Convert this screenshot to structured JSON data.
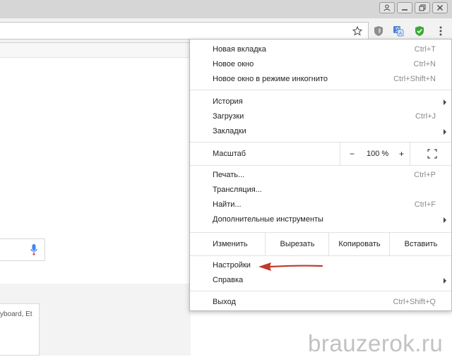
{
  "menu": {
    "items": [
      {
        "label": "Новая вкладка",
        "shortcut": "Ctrl+T"
      },
      {
        "label": "Новое окно",
        "shortcut": "Ctrl+N"
      },
      {
        "label": "Новое окно в режиме инкогнито",
        "shortcut": "Ctrl+Shift+N"
      },
      {
        "label": "История",
        "shortcut": ""
      },
      {
        "label": "Загрузки",
        "shortcut": "Ctrl+J"
      },
      {
        "label": "Закладки",
        "shortcut": ""
      },
      {
        "label": "Печать...",
        "shortcut": "Ctrl+P"
      },
      {
        "label": "Трансляция...",
        "shortcut": ""
      },
      {
        "label": "Найти...",
        "shortcut": "Ctrl+F"
      },
      {
        "label": "Дополнительные инструменты",
        "shortcut": ""
      },
      {
        "label": "Настройки",
        "shortcut": ""
      },
      {
        "label": "Справка",
        "shortcut": ""
      },
      {
        "label": "Выход",
        "shortcut": "Ctrl+Shift+Q"
      }
    ],
    "zoom": {
      "label": "Масштаб",
      "minus": "−",
      "value": "100 %",
      "plus": "+"
    },
    "edit": {
      "label": "Изменить",
      "cut": "Вырезать",
      "copy": "Копировать",
      "paste": "Вставить"
    }
  },
  "page": {
    "thumbnail_title": "yboard, Et"
  },
  "watermark": "brauzerok.ru",
  "colors": {
    "annotation_arrow": "#c0392b",
    "shield_green": "#3aaa35",
    "mic_blue": "#4285f4"
  }
}
